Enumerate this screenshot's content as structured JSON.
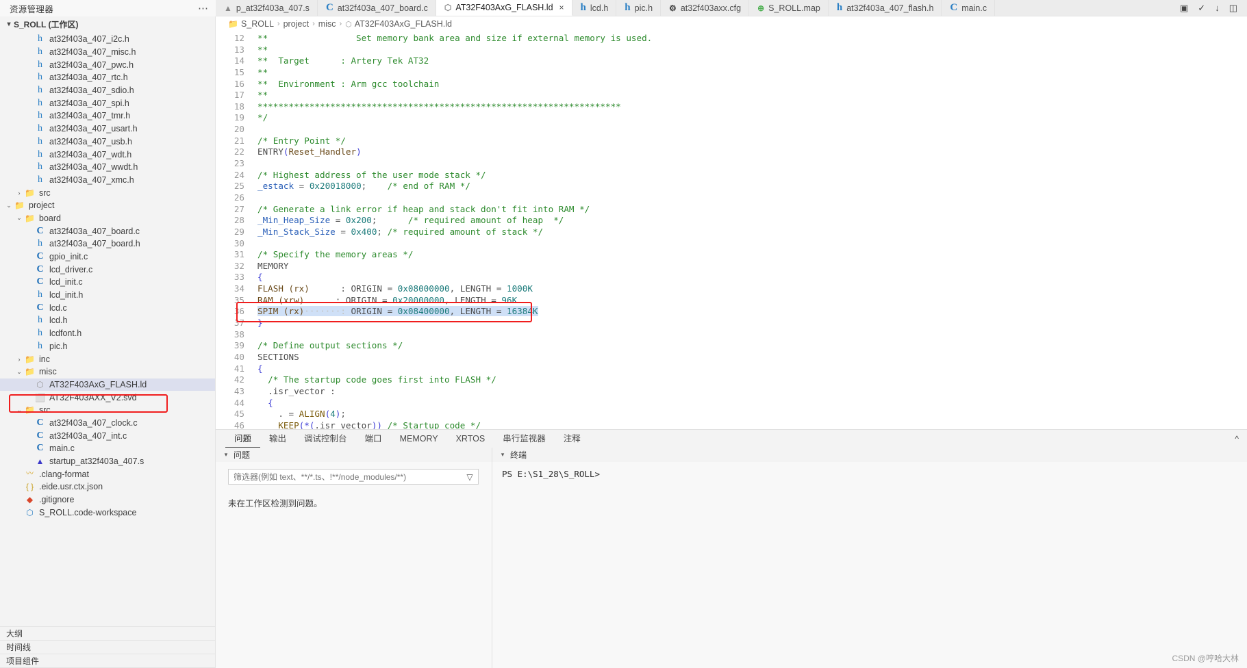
{
  "sidebar": {
    "title": "资源管理器",
    "more_label": "⋯",
    "workspace": "S_ROLL (工作区)",
    "bottom_sections": [
      "大纲",
      "时间线",
      "项目组件"
    ],
    "tree": [
      {
        "label": "at32f403a_407_i2c.h",
        "icon": "h-file-icon",
        "indent": 3,
        "chev": ""
      },
      {
        "label": "at32f403a_407_misc.h",
        "icon": "h-file-icon",
        "indent": 3,
        "chev": ""
      },
      {
        "label": "at32f403a_407_pwc.h",
        "icon": "h-file-icon",
        "indent": 3,
        "chev": ""
      },
      {
        "label": "at32f403a_407_rtc.h",
        "icon": "h-file-icon",
        "indent": 3,
        "chev": ""
      },
      {
        "label": "at32f403a_407_sdio.h",
        "icon": "h-file-icon",
        "indent": 3,
        "chev": ""
      },
      {
        "label": "at32f403a_407_spi.h",
        "icon": "h-file-icon",
        "indent": 3,
        "chev": ""
      },
      {
        "label": "at32f403a_407_tmr.h",
        "icon": "h-file-icon",
        "indent": 3,
        "chev": ""
      },
      {
        "label": "at32f403a_407_usart.h",
        "icon": "h-file-icon",
        "indent": 3,
        "chev": ""
      },
      {
        "label": "at32f403a_407_usb.h",
        "icon": "h-file-icon",
        "indent": 3,
        "chev": ""
      },
      {
        "label": "at32f403a_407_wdt.h",
        "icon": "h-file-icon",
        "indent": 3,
        "chev": ""
      },
      {
        "label": "at32f403a_407_wwdt.h",
        "icon": "h-file-icon",
        "indent": 3,
        "chev": ""
      },
      {
        "label": "at32f403a_407_xmc.h",
        "icon": "h-file-icon",
        "indent": 3,
        "chev": ""
      },
      {
        "label": "src",
        "icon": "folder-src-icon",
        "indent": 2,
        "chev": "collapsed"
      },
      {
        "label": "project",
        "icon": "folder-icon",
        "indent": 1,
        "chev": "expanded"
      },
      {
        "label": "board",
        "icon": "folder-icon",
        "indent": 2,
        "chev": "expanded"
      },
      {
        "label": "at32f403a_407_board.c",
        "icon": "c-file-icon",
        "indent": 3,
        "chev": ""
      },
      {
        "label": "at32f403a_407_board.h",
        "icon": "h-file-icon",
        "indent": 3,
        "chev": ""
      },
      {
        "label": "gpio_init.c",
        "icon": "c-file-icon",
        "indent": 3,
        "chev": ""
      },
      {
        "label": "lcd_driver.c",
        "icon": "c-file-icon",
        "indent": 3,
        "chev": ""
      },
      {
        "label": "lcd_init.c",
        "icon": "c-file-icon",
        "indent": 3,
        "chev": ""
      },
      {
        "label": "lcd_init.h",
        "icon": "h-file-icon",
        "indent": 3,
        "chev": ""
      },
      {
        "label": "lcd.c",
        "icon": "c-file-icon",
        "indent": 3,
        "chev": ""
      },
      {
        "label": "lcd.h",
        "icon": "h-file-icon",
        "indent": 3,
        "chev": ""
      },
      {
        "label": "lcdfont.h",
        "icon": "h-file-icon",
        "indent": 3,
        "chev": ""
      },
      {
        "label": "pic.h",
        "icon": "h-file-icon",
        "indent": 3,
        "chev": ""
      },
      {
        "label": "inc",
        "icon": "folder-inc-icon",
        "indent": 2,
        "chev": "collapsed"
      },
      {
        "label": "misc",
        "icon": "folder-icon",
        "indent": 2,
        "chev": "expanded"
      },
      {
        "label": "AT32F403AxG_FLASH.ld",
        "icon": "ld-file-icon",
        "indent": 3,
        "chev": "",
        "selected": true
      },
      {
        "label": "AT32F403AXX_V2.svd",
        "icon": "svd-file-icon",
        "indent": 3,
        "chev": ""
      },
      {
        "label": "src",
        "icon": "folder-src-icon",
        "indent": 2,
        "chev": "expanded"
      },
      {
        "label": "at32f403a_407_clock.c",
        "icon": "c-file-icon",
        "indent": 3,
        "chev": ""
      },
      {
        "label": "at32f403a_407_int.c",
        "icon": "c-file-icon",
        "indent": 3,
        "chev": ""
      },
      {
        "label": "main.c",
        "icon": "c-file-icon",
        "indent": 3,
        "chev": ""
      },
      {
        "label": "startup_at32f403a_407.s",
        "icon": "asm-file-icon",
        "indent": 3,
        "chev": ""
      },
      {
        "label": ".clang-format",
        "icon": "clang-file-icon",
        "indent": 2,
        "chev": ""
      },
      {
        "label": ".eide.usr.ctx.json",
        "icon": "json-file-icon",
        "indent": 2,
        "chev": ""
      },
      {
        "label": ".gitignore",
        "icon": "git-file-icon",
        "indent": 2,
        "chev": ""
      },
      {
        "label": "S_ROLL.code-workspace",
        "icon": "workspace-icon",
        "indent": 2,
        "chev": ""
      }
    ]
  },
  "tabs": [
    {
      "label": "p_at32f403a_407.s",
      "icon": "asm-file-icon",
      "active": false,
      "closable": false
    },
    {
      "label": "at32f403a_407_board.c",
      "icon": "c-file-icon",
      "active": false,
      "closable": false
    },
    {
      "label": "AT32F403AxG_FLASH.ld",
      "icon": "ld-file-icon",
      "active": true,
      "closable": true
    },
    {
      "label": "lcd.h",
      "icon": "h-file-icon",
      "active": false,
      "closable": false
    },
    {
      "label": "pic.h",
      "icon": "h-file-icon",
      "active": false,
      "closable": false
    },
    {
      "label": "at32f403axx.cfg",
      "icon": "gear-icon",
      "active": false,
      "closable": false
    },
    {
      "label": "S_ROLL.map",
      "icon": "globe-icon",
      "active": false,
      "closable": false
    },
    {
      "label": "at32f403a_407_flash.h",
      "icon": "h-file-icon",
      "active": false,
      "closable": false
    },
    {
      "label": "main.c",
      "icon": "c-file-icon",
      "active": false,
      "closable": false
    }
  ],
  "tab_actions": [
    "build-icon",
    "clean-icon",
    "download-icon",
    "split-editor-icon"
  ],
  "breadcrumb": [
    "S_ROLL",
    "project",
    "misc",
    "AT32F403AxG_FLASH.ld"
  ],
  "editor": {
    "lines": [
      {
        "n": 12,
        "segs": [
          {
            "t": "**                 Set memory bank area and size if external memory is used.",
            "c": "cm"
          }
        ]
      },
      {
        "n": 13,
        "segs": [
          {
            "t": "**",
            "c": "cm"
          }
        ]
      },
      {
        "n": 14,
        "segs": [
          {
            "t": "**  Target      : Artery Tek AT32",
            "c": "cm"
          }
        ]
      },
      {
        "n": 15,
        "segs": [
          {
            "t": "**",
            "c": "cm"
          }
        ]
      },
      {
        "n": 16,
        "segs": [
          {
            "t": "**  Environment : Arm gcc toolchain",
            "c": "cm"
          }
        ]
      },
      {
        "n": 17,
        "segs": [
          {
            "t": "**",
            "c": "cm"
          }
        ]
      },
      {
        "n": 18,
        "segs": [
          {
            "t": "**********************************************************************",
            "c": "cm"
          }
        ]
      },
      {
        "n": 19,
        "segs": [
          {
            "t": "*/",
            "c": "cm"
          }
        ]
      },
      {
        "n": 20,
        "segs": []
      },
      {
        "n": 21,
        "segs": [
          {
            "t": "/* Entry Point */",
            "c": "cm"
          }
        ]
      },
      {
        "n": 22,
        "segs": [
          {
            "t": "ENTRY",
            "c": "kw"
          },
          {
            "t": "(",
            "c": "br"
          },
          {
            "t": "Reset_Handler",
            "c": "id"
          },
          {
            "t": ")",
            "c": "br"
          }
        ]
      },
      {
        "n": 23,
        "segs": []
      },
      {
        "n": 24,
        "segs": [
          {
            "t": "/* Highest address of the user mode stack */",
            "c": "cm"
          }
        ]
      },
      {
        "n": 25,
        "segs": [
          {
            "t": "_estack ",
            "c": "var"
          },
          {
            "t": "= ",
            "c": "op"
          },
          {
            "t": "0x20018000",
            "c": "num"
          },
          {
            "t": ";    ",
            "c": "op"
          },
          {
            "t": "/* end of RAM */",
            "c": "cm"
          }
        ]
      },
      {
        "n": 26,
        "segs": []
      },
      {
        "n": 27,
        "segs": [
          {
            "t": "/* Generate a link error if heap and stack don't fit into RAM */",
            "c": "cm"
          }
        ]
      },
      {
        "n": 28,
        "segs": [
          {
            "t": "_Min_Heap_Size ",
            "c": "var"
          },
          {
            "t": "= ",
            "c": "op"
          },
          {
            "t": "0x200",
            "c": "num"
          },
          {
            "t": ";      ",
            "c": "op"
          },
          {
            "t": "/* required amount of heap  */",
            "c": "cm"
          }
        ]
      },
      {
        "n": 29,
        "segs": [
          {
            "t": "_Min_Stack_Size ",
            "c": "var"
          },
          {
            "t": "= ",
            "c": "op"
          },
          {
            "t": "0x400",
            "c": "num"
          },
          {
            "t": "; ",
            "c": "op"
          },
          {
            "t": "/* required amount of stack */",
            "c": "cm"
          }
        ]
      },
      {
        "n": 30,
        "segs": []
      },
      {
        "n": 31,
        "segs": [
          {
            "t": "/* Specify the memory areas */",
            "c": "cm"
          }
        ]
      },
      {
        "n": 32,
        "segs": [
          {
            "t": "MEMORY",
            "c": "kw"
          }
        ]
      },
      {
        "n": 33,
        "segs": [
          {
            "t": "{",
            "c": "br"
          }
        ]
      },
      {
        "n": 34,
        "segs": [
          {
            "t": "FLASH (rx)",
            "c": "id"
          },
          {
            "t": "      : ",
            "c": "op"
          },
          {
            "t": "ORIGIN ",
            "c": "kw"
          },
          {
            "t": "= ",
            "c": "op"
          },
          {
            "t": "0x08000000",
            "c": "num"
          },
          {
            "t": ", ",
            "c": "op"
          },
          {
            "t": "LENGTH ",
            "c": "kw"
          },
          {
            "t": "= ",
            "c": "op"
          },
          {
            "t": "1000K",
            "c": "num"
          }
        ]
      },
      {
        "n": 35,
        "segs": [
          {
            "t": "RAM (xrw)",
            "c": "id"
          },
          {
            "t": "      : ",
            "c": "op"
          },
          {
            "t": "ORIGIN ",
            "c": "kw"
          },
          {
            "t": "= ",
            "c": "op"
          },
          {
            "t": "0x20000000",
            "c": "num"
          },
          {
            "t": ", ",
            "c": "op"
          },
          {
            "t": "LENGTH ",
            "c": "kw"
          },
          {
            "t": "= ",
            "c": "op"
          },
          {
            "t": "96K",
            "c": "num"
          }
        ]
      },
      {
        "n": 36,
        "segs": [
          {
            "t": "SPIM (rx)",
            "c": "id"
          },
          {
            "t": "·······: ",
            "c": "dot"
          },
          {
            "t": "ORIGIN ",
            "c": "kw"
          },
          {
            "t": "= ",
            "c": "op"
          },
          {
            "t": "0x08400000",
            "c": "num"
          },
          {
            "t": ", ",
            "c": "op"
          },
          {
            "t": "LENGTH ",
            "c": "kw"
          },
          {
            "t": "= ",
            "c": "op"
          },
          {
            "t": "16384K",
            "c": "num"
          }
        ],
        "selected": true
      },
      {
        "n": 37,
        "segs": [
          {
            "t": "}",
            "c": "br"
          }
        ]
      },
      {
        "n": 38,
        "segs": []
      },
      {
        "n": 39,
        "segs": [
          {
            "t": "/* Define output sections */",
            "c": "cm"
          }
        ]
      },
      {
        "n": 40,
        "segs": [
          {
            "t": "SECTIONS",
            "c": "kw"
          }
        ]
      },
      {
        "n": 41,
        "segs": [
          {
            "t": "{",
            "c": "br"
          }
        ]
      },
      {
        "n": 42,
        "segs": [
          {
            "t": "  /* The startup code goes first into FLASH */",
            "c": "cm"
          }
        ]
      },
      {
        "n": 43,
        "segs": [
          {
            "t": "  .isr_vector :",
            "c": "kw"
          }
        ]
      },
      {
        "n": 44,
        "segs": [
          {
            "t": "  {",
            "c": "br"
          }
        ]
      },
      {
        "n": 45,
        "segs": [
          {
            "t": "    . ",
            "c": "op"
          },
          {
            "t": "= ",
            "c": "op"
          },
          {
            "t": "ALIGN",
            "c": "fn"
          },
          {
            "t": "(",
            "c": "br"
          },
          {
            "t": "4",
            "c": "num"
          },
          {
            "t": ")",
            "c": "br"
          },
          {
            "t": ";",
            "c": "op"
          }
        ]
      },
      {
        "n": 46,
        "segs": [
          {
            "t": "    KEEP",
            "c": "fn"
          },
          {
            "t": "(*(",
            "c": "br"
          },
          {
            "t": ".isr vector",
            "c": "kw"
          },
          {
            "t": "))",
            "c": "br"
          },
          {
            "t": " /* Startup code */",
            "c": "cm"
          }
        ]
      }
    ]
  },
  "panel": {
    "tabs": [
      "问题",
      "输出",
      "调试控制台",
      "端口",
      "MEMORY",
      "XRTOS",
      "串行监视器",
      "注释"
    ],
    "active_tab": "问题",
    "collapse_icon": "chevron-up-icon",
    "problems": {
      "header": "问题",
      "filter_placeholder": "筛选器(例如 text、**/*.ts、!**/node_modules/**)",
      "filter_value": "",
      "filter_icon": "filter-icon",
      "empty_message": "未在工作区检测到问题。"
    },
    "terminal": {
      "header": "终端",
      "prompt": "PS E:\\S1_28\\S_ROLL>"
    }
  },
  "watermark": "CSDN @哼哈大林",
  "colors": {
    "accent_red": "#f01d1d",
    "selection_blue": "#cfe0f7",
    "tree_selected": "#dcdfee"
  }
}
